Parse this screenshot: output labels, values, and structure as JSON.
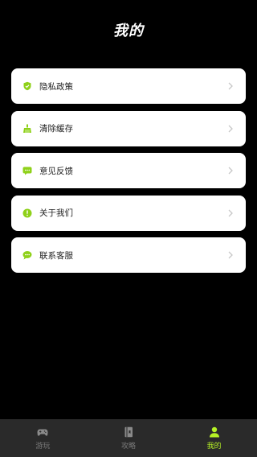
{
  "header": {
    "title": "我的"
  },
  "accent": "#b6f226",
  "menu": {
    "items": [
      {
        "label": "隐私政策",
        "icon": "shield-icon"
      },
      {
        "label": "清除缓存",
        "icon": "broom-icon"
      },
      {
        "label": "意见反馈",
        "icon": "feedback-icon"
      },
      {
        "label": "关于我们",
        "icon": "info-icon"
      },
      {
        "label": "联系客服",
        "icon": "chat-icon"
      }
    ]
  },
  "tabbar": {
    "tabs": [
      {
        "label": "游玩",
        "icon": "gamepad-icon",
        "active": false
      },
      {
        "label": "攻略",
        "icon": "guide-book-icon",
        "active": false
      },
      {
        "label": "我的",
        "icon": "person-icon",
        "active": true
      }
    ]
  }
}
